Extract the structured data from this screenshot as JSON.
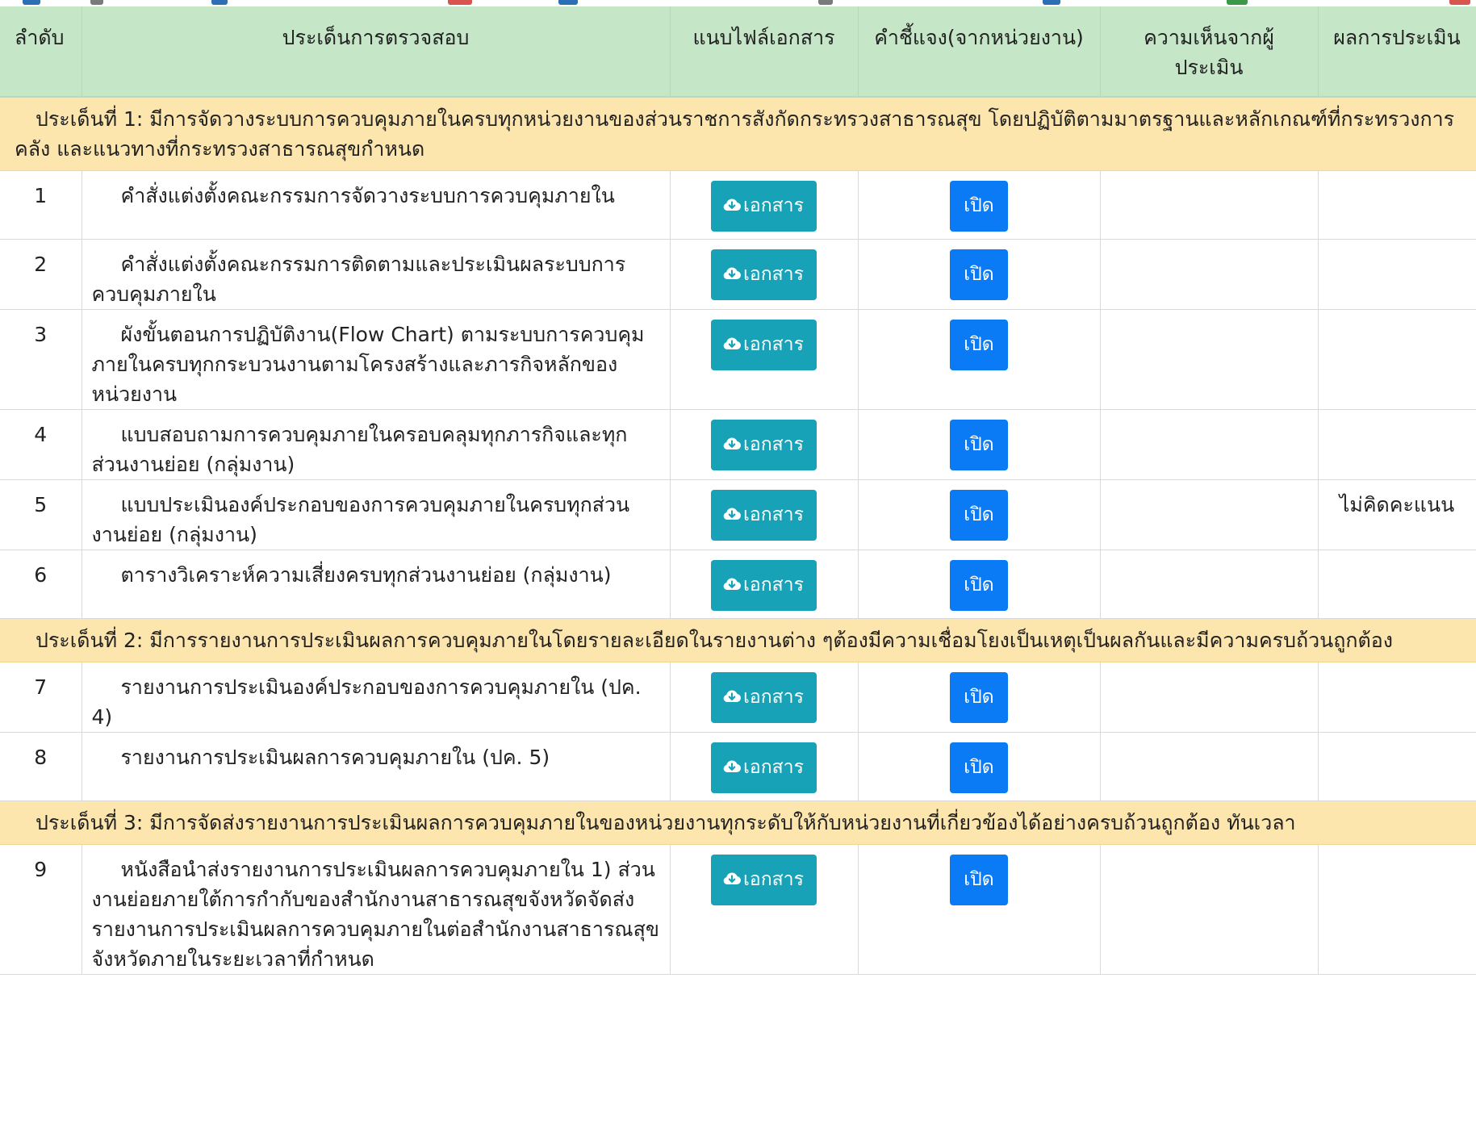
{
  "colors": {
    "header_bg": "#c6e6c8",
    "section_bg": "#fde6ae",
    "doc_button": "#17a2b8",
    "open_button": "#0b7bf5"
  },
  "table": {
    "headers": {
      "no": "ลำดับ",
      "topic": "ประเด็นการตรวจสอบ",
      "attach": "แนบไฟล์เอกสาร",
      "explain": "คำชี้แจง(จากหน่วยงาน)",
      "opinion": "ความเห็นจากผู้ประเมิน",
      "result": "ผลการประเมิน"
    },
    "doc_button_label": "เอกสาร",
    "open_button_label": "เปิด",
    "doc_button_icon": "cloud-download-icon",
    "sections": [
      {
        "title": "ประเด็นที่ 1: มีการจัดวางระบบการควบคุมภายในครบทุกหน่วยงานของส่วนราชการสังกัดกระทรวงสาธารณสุข โดยปฏิบัติตามมาตรฐานและหลักเกณฑ์ที่กระทรวงการคลัง และแนวทางที่กระทรวงสาธารณสุขกำหนด",
        "items": [
          {
            "no": "1",
            "topic": "คำสั่งแต่งตั้งคณะกรรมการจัดวางระบบการควบคุมภายใน",
            "opinion": "",
            "result": ""
          },
          {
            "no": "2",
            "topic": "คำสั่งแต่งตั้งคณะกรรมการติดตามและประเมินผลระบบการควบคุมภายใน",
            "opinion": "",
            "result": ""
          },
          {
            "no": "3",
            "topic": "ผังขั้นตอนการปฏิบัติงาน(Flow Chart) ตามระบบการควบคุมภายในครบทุกกระบวนงานตามโครงสร้างและภารกิจหลักของหน่วยงาน",
            "opinion": "",
            "result": ""
          },
          {
            "no": "4",
            "topic": "แบบสอบถามการควบคุมภายในครอบคลุมทุกภารกิจและทุกส่วนงานย่อย (กลุ่มงาน)",
            "opinion": "",
            "result": ""
          },
          {
            "no": "5",
            "topic": "แบบประเมินองค์ประกอบของการควบคุมภายในครบทุกส่วนงานย่อย (กลุ่มงาน)",
            "opinion": "",
            "result": "ไม่คิดคะแนน"
          },
          {
            "no": "6",
            "topic": "ตารางวิเคราะห์ความเสี่ยงครบทุกส่วนงานย่อย (กลุ่มงาน)",
            "opinion": "",
            "result": ""
          }
        ]
      },
      {
        "title": "ประเด็นที่ 2: มีการรายงานการประเมินผลการควบคุมภายในโดยรายละเอียดในรายงานต่าง ๆต้องมีความเชื่อมโยงเป็นเหตุเป็นผลกันและมีความครบถ้วนถูกต้อง",
        "items": [
          {
            "no": "7",
            "topic": "รายงานการประเมินองค์ประกอบของการควบคุมภายใน (ปค. 4)",
            "opinion": "",
            "result": ""
          },
          {
            "no": "8",
            "topic": "รายงานการประเมินผลการควบคุมภายใน (ปค. 5)",
            "opinion": "",
            "result": ""
          }
        ]
      },
      {
        "title": "ประเด็นที่ 3: มีการจัดส่งรายงานการประเมินผลการควบคุมภายในของหน่วยงานทุกระดับให้กับหน่วยงานที่เกี่ยวข้องได้อย่างครบถ้วนถูกต้อง ทันเวลา",
        "items": [
          {
            "no": "9",
            "topic": "หนังสือนำส่งรายงานการประเมินผลการควบคุมภายใน 1) ส่วนงานย่อยภายใต้การกำกับของสำนักงานสาธารณสุขจังหวัดจัดส่งรายงานการประเมินผลการควบคุมภายในต่อสำนักงานสาธารณสุขจังหวัดภายในระยะเวลาที่กำหนด",
            "opinion": "",
            "result": ""
          }
        ]
      }
    ]
  }
}
